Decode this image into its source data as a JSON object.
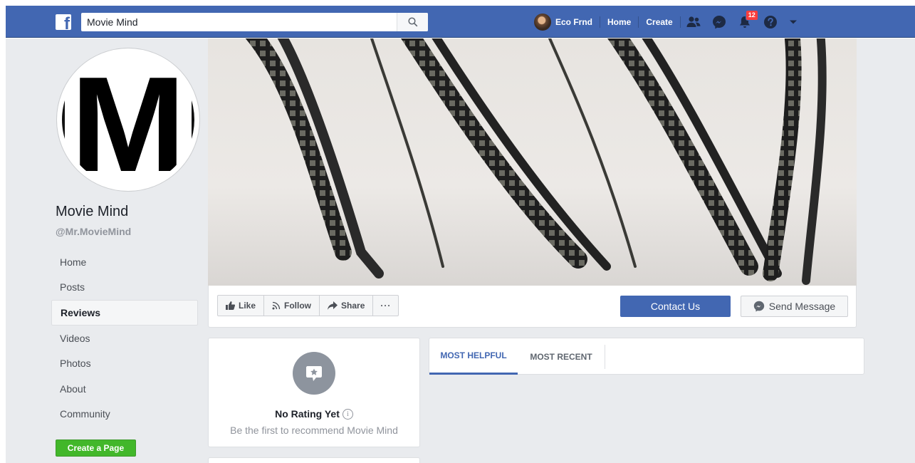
{
  "header": {
    "search_value": "Movie Mind",
    "user_name": "Eco Frnd",
    "home_label": "Home",
    "create_label": "Create",
    "notification_count": "12"
  },
  "page": {
    "name": "Movie Mind",
    "handle": "@Mr.MovieMind",
    "logo_letter": "M"
  },
  "sidebar": {
    "items": [
      {
        "label": "Home"
      },
      {
        "label": "Posts"
      },
      {
        "label": "Reviews"
      },
      {
        "label": "Videos"
      },
      {
        "label": "Photos"
      },
      {
        "label": "About"
      },
      {
        "label": "Community"
      }
    ],
    "active": "Reviews",
    "create_page_label": "Create a Page"
  },
  "actions": {
    "like_label": "Like",
    "follow_label": "Follow",
    "share_label": "Share",
    "more_label": "···",
    "contact_label": "Contact Us",
    "message_label": "Send Message"
  },
  "rating": {
    "title": "No Rating Yet",
    "subtitle": "Be the first to recommend Movie Mind"
  },
  "reviews": {
    "tabs": [
      {
        "label": "MOST HELPFUL"
      },
      {
        "label": "MOST RECENT"
      }
    ]
  },
  "colors": {
    "brand": "#4267b2",
    "create_page": "#42b72a",
    "badge": "#fa3e3e",
    "background": "#e9ebee"
  }
}
